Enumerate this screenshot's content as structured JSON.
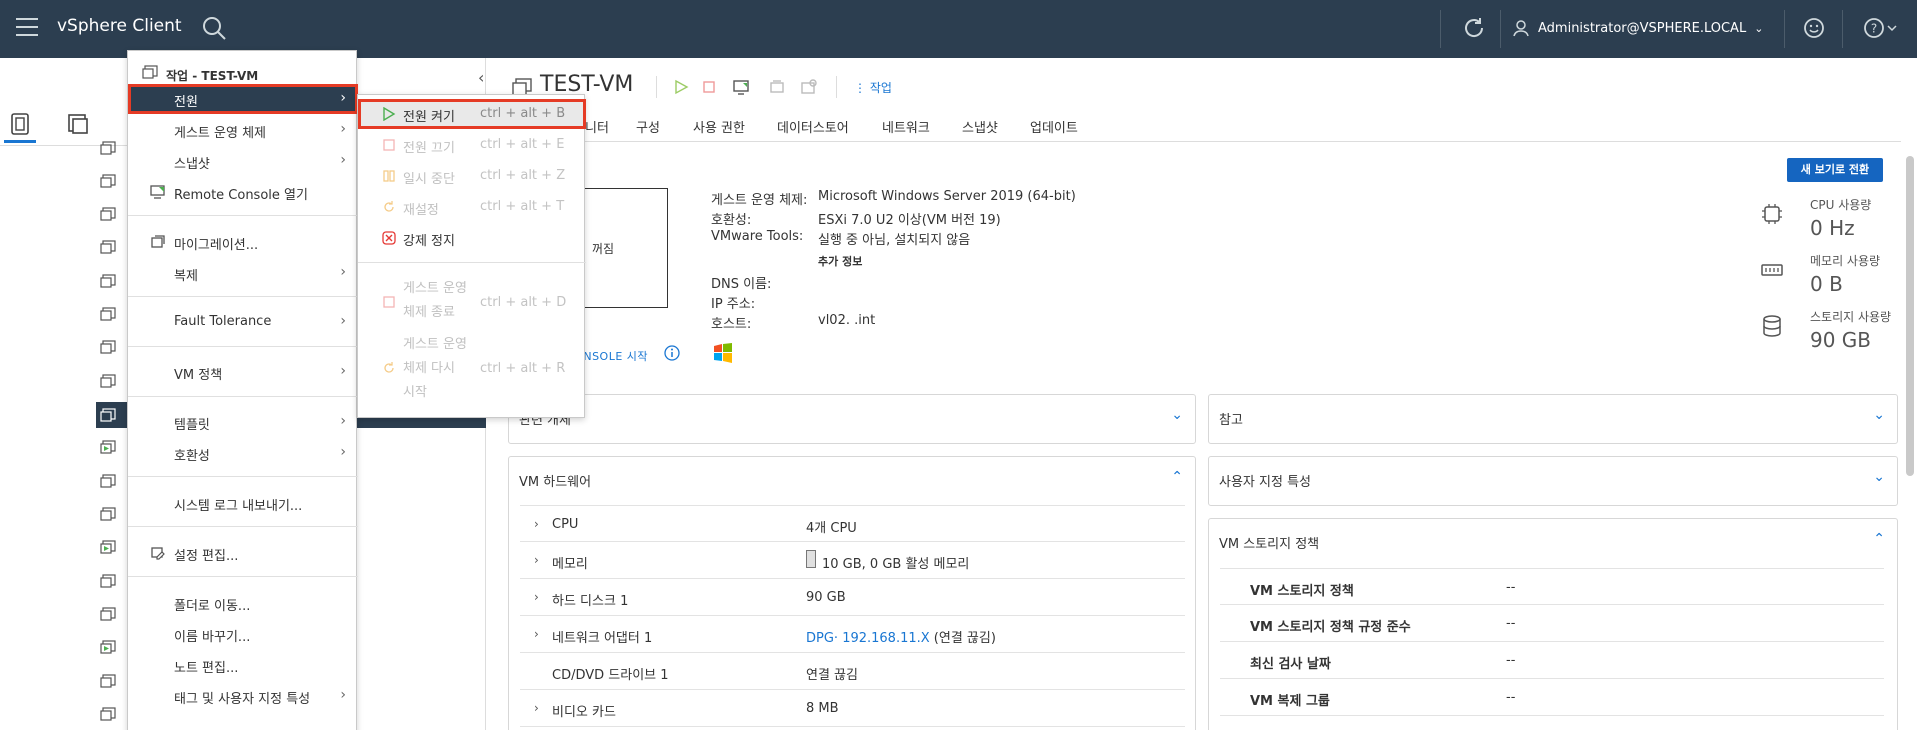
{
  "header": {
    "app_title": "vSphere Client",
    "user": "Administrator@VSPHERE.LOCAL"
  },
  "context_menu": {
    "title": "작업 - TEST-VM",
    "items": [
      {
        "label": "전원",
        "submenu": true
      },
      {
        "label": "게스트 운영 체제",
        "submenu": true
      },
      {
        "label": "스냅샷",
        "submenu": true
      },
      {
        "label": "Remote Console 열기",
        "submenu": false
      },
      {
        "label": "마이그레이션...",
        "submenu": false
      },
      {
        "label": "복제",
        "submenu": true
      },
      {
        "label": "Fault Tolerance",
        "submenu": true
      },
      {
        "label": "VM 정책",
        "submenu": true
      },
      {
        "label": "템플릿",
        "submenu": true
      },
      {
        "label": "호환성",
        "submenu": true
      },
      {
        "label": "시스템 로그 내보내기...",
        "submenu": false
      },
      {
        "label": "설정 편집...",
        "submenu": false
      },
      {
        "label": "폴더로 이동...",
        "submenu": false
      },
      {
        "label": "이름 바꾸기...",
        "submenu": false
      },
      {
        "label": "노트 편집...",
        "submenu": false
      },
      {
        "label": "태그 및 사용자 지정 특성",
        "submenu": true
      }
    ]
  },
  "power_submenu": {
    "items": [
      {
        "label": "전원 켜기",
        "shortcut": "ctrl + alt + B",
        "enabled": true
      },
      {
        "label": "전원 끄기",
        "shortcut": "ctrl + alt + E",
        "enabled": false
      },
      {
        "label": "일시 중단",
        "shortcut": "ctrl + alt + Z",
        "enabled": false
      },
      {
        "label": "재설정",
        "shortcut": "ctrl + alt + T",
        "enabled": false
      },
      {
        "label": "강제 정지",
        "shortcut": "",
        "enabled": true
      }
    ],
    "shutdown": {
      "line1": "게스트 운영",
      "line2": "체제 종료",
      "shortcut": "ctrl + alt + D"
    },
    "restart": {
      "line1": "게스트 운영",
      "line2": "체제 다시",
      "line3": "시작",
      "shortcut": "ctrl + alt + R"
    }
  },
  "vm": {
    "name": "TEST-VM",
    "actions_label": "작업",
    "tabs": [
      "모니터",
      "구성",
      "사용 권한",
      "데이터스토어",
      "네트워크",
      "스냅샷",
      "업데이트"
    ],
    "tab_monitor_visible": "니터",
    "power_state": "꺼짐",
    "console_link": "CONSOLE 시작",
    "switch_view": "새 보기로 전환",
    "properties": [
      {
        "label": "게스트 운영 체제:",
        "value": "Microsoft Windows Server 2019 (64-bit)"
      },
      {
        "label": "호환성:",
        "value": "ESXi 7.0 U2 이상(VM 버전 19)"
      },
      {
        "label": "VMware Tools:",
        "value": "실행 중 아님, 설치되지 않음"
      },
      {
        "label": "DNS 이름:",
        "value": ""
      },
      {
        "label": "IP 주소:",
        "value": ""
      },
      {
        "label": "호스트:",
        "value": "vl02.        .int"
      }
    ],
    "more_info": "추가 정보",
    "metrics": [
      {
        "label": "CPU 사용량",
        "value": "0 Hz"
      },
      {
        "label": "메모리 사용량",
        "value": "0 B"
      },
      {
        "label": "스토리지 사용량",
        "value": "90 GB"
      }
    ]
  },
  "cards": {
    "related": "관련 개체",
    "notes": "참고",
    "hardware": "VM 하드웨어",
    "custom_attrs": "사용자 지정 특성",
    "storage_policy": "VM 스토리지 정책"
  },
  "hardware": [
    {
      "key": "CPU",
      "value": "4개 CPU",
      "expand": true,
      "link": false
    },
    {
      "key": "메모리",
      "value": "10 GB, 0 GB 활성 메모리",
      "expand": true,
      "link": false
    },
    {
      "key": "하드 디스크 1",
      "value": "90 GB",
      "expand": true,
      "link": false
    },
    {
      "key": "네트워크 어댑터 1",
      "value": "DPG·  192.168.11.X",
      "value_suffix": " (연결 끊김)",
      "expand": true,
      "link": true
    },
    {
      "key": "CD/DVD 드라이브 1",
      "value": "연결 끊김",
      "expand": false,
      "link": false
    },
    {
      "key": "비디오 카드",
      "value": "8 MB",
      "expand": true,
      "link": false
    }
  ],
  "storage_policy_rows": [
    {
      "key": "VM 스토리지 정책",
      "value": "--"
    },
    {
      "key": "VM 스토리지 정책 규정 준수",
      "value": "--"
    },
    {
      "key": "최신 검사 날짜",
      "value": "--"
    },
    {
      "key": "VM 복제 그룹",
      "value": "--"
    }
  ],
  "colors": {
    "header_bg": "#2c3e50",
    "highlight": "#e53b25",
    "link": "#1976d2"
  }
}
